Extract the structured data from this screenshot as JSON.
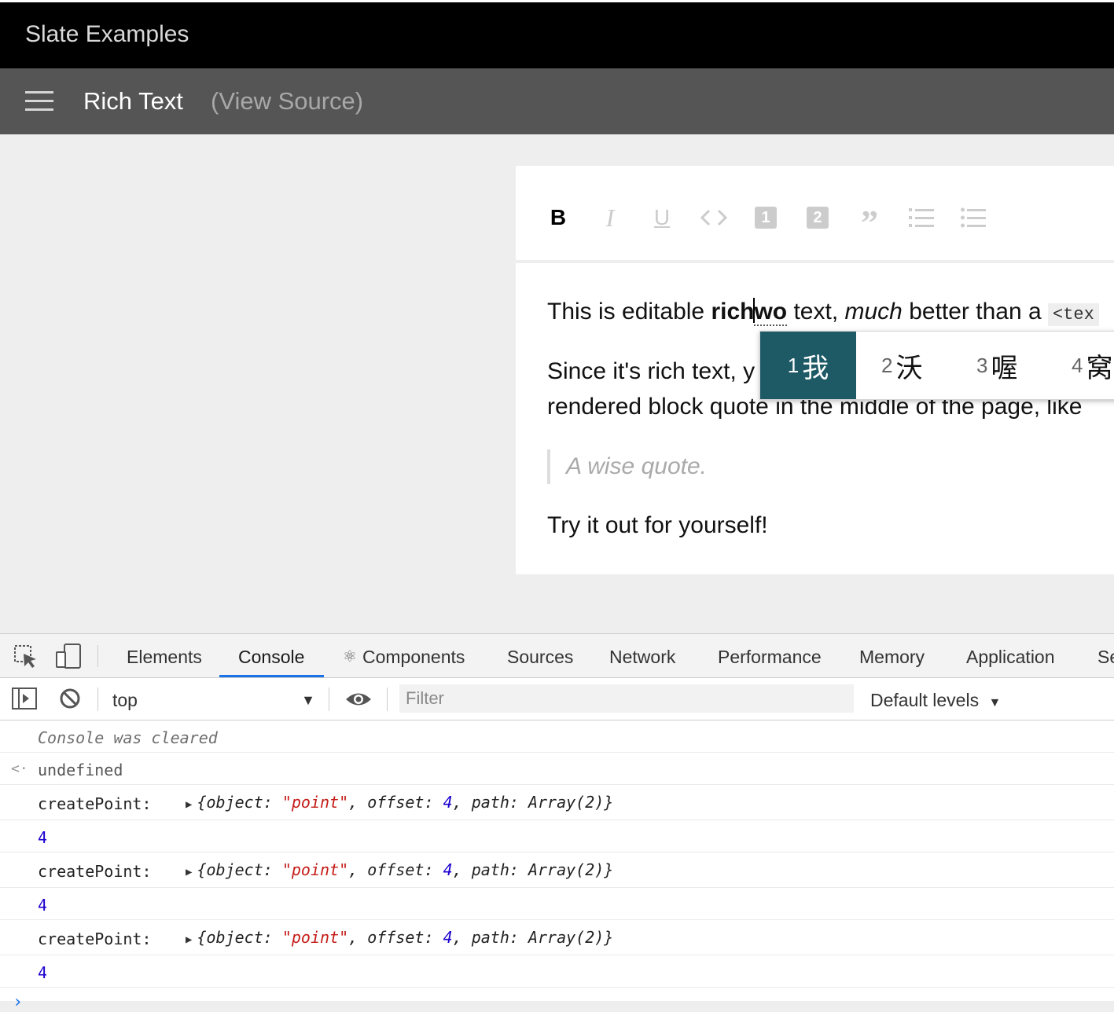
{
  "header": {
    "app_title": "Slate Examples",
    "example_title": "Rich Text",
    "view_source": "(View Source)"
  },
  "toolbar": {
    "buttons": [
      {
        "name": "bold",
        "label": "B"
      },
      {
        "name": "italic",
        "label": "I"
      },
      {
        "name": "underline",
        "label": "U"
      },
      {
        "name": "code",
        "label": "<>"
      },
      {
        "name": "heading-one",
        "label": "1"
      },
      {
        "name": "heading-two",
        "label": "2"
      },
      {
        "name": "block-quote",
        "label": "”"
      },
      {
        "name": "numbered-list",
        "label": ""
      },
      {
        "name": "bulleted-list",
        "label": ""
      }
    ]
  },
  "editor": {
    "p1": {
      "t1": "This is editable ",
      "bold_a": "rich",
      "bold_b": "wo",
      "t2": " text, ",
      "italic": "much",
      "t3": " better than a ",
      "code": "<tex"
    },
    "p2_line1": "Since it's rich text, y",
    "p2_line2": "rendered block quote in the middle of the page, like",
    "quote": "A wise quote.",
    "p3": "Try it out for yourself!"
  },
  "ime": {
    "candidates": [
      {
        "num": "1",
        "char": "我"
      },
      {
        "num": "2",
        "char": "沃"
      },
      {
        "num": "3",
        "char": "喔"
      },
      {
        "num": "4",
        "char": "窝"
      }
    ]
  },
  "devtools": {
    "tabs": [
      "Elements",
      "Console",
      "Components",
      "Sources",
      "Network",
      "Performance",
      "Memory",
      "Application",
      "Se"
    ],
    "active_tab": "Console",
    "context": "top",
    "filter_placeholder": "Filter",
    "levels": "Default levels",
    "console": {
      "cleared": "Console was cleared",
      "return_value": "undefined",
      "entries": [
        {
          "label": "createPoint:",
          "object_key": "object",
          "object_val": "\"point\"",
          "offset_key": "offset",
          "offset_val": "4",
          "path_key": "path",
          "path_val": "Array(2)",
          "result": "4"
        },
        {
          "label": "createPoint:",
          "object_key": "object",
          "object_val": "\"point\"",
          "offset_key": "offset",
          "offset_val": "4",
          "path_key": "path",
          "path_val": "Array(2)",
          "result": "4"
        },
        {
          "label": "createPoint:",
          "object_key": "object",
          "object_val": "\"point\"",
          "offset_key": "offset",
          "offset_val": "4",
          "path_key": "path",
          "path_val": "Array(2)",
          "result": "4"
        }
      ]
    }
  }
}
